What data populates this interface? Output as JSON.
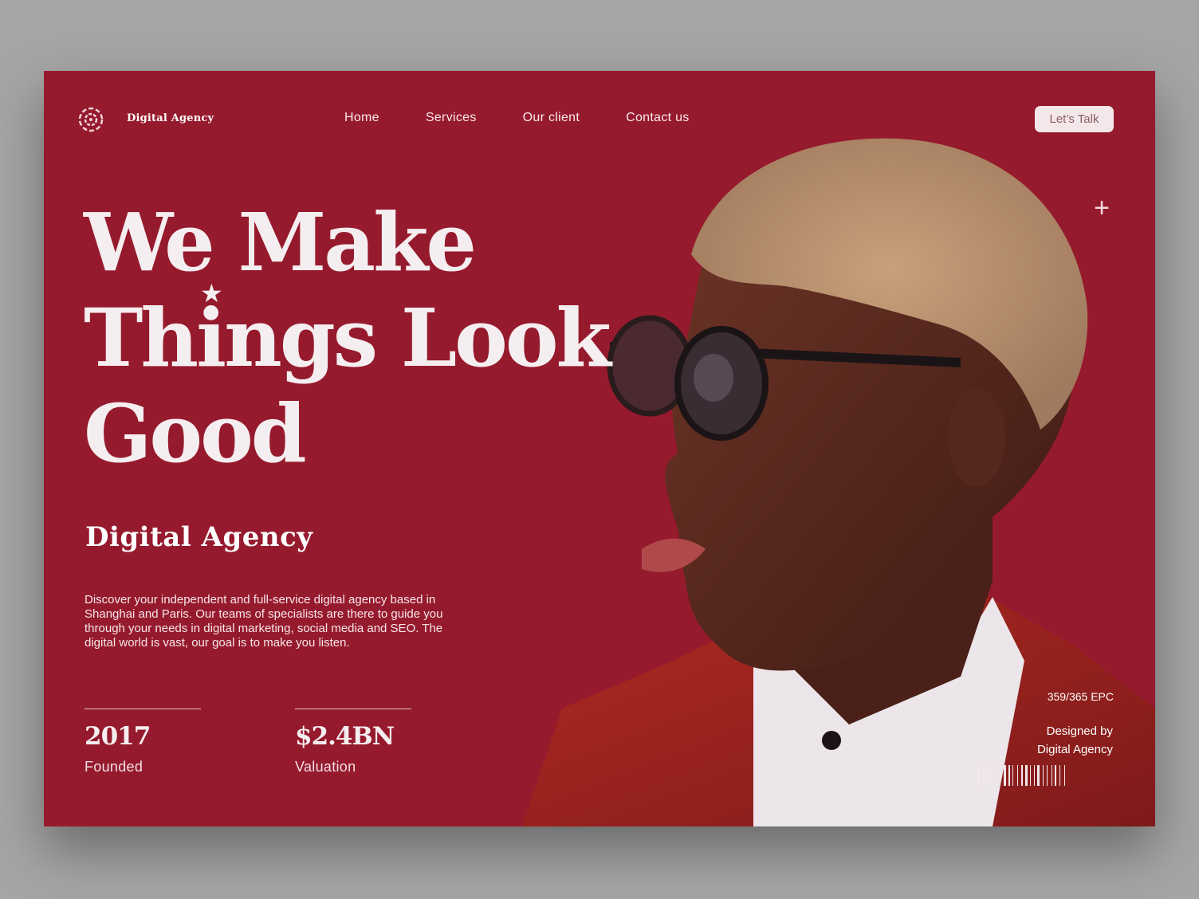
{
  "brand": {
    "name": "Digital Agency"
  },
  "nav": {
    "items": [
      "Home",
      "Services",
      "Our client",
      "Contact us"
    ],
    "cta_label": "Let’s Talk",
    "plus_symbol": "+"
  },
  "hero": {
    "headline": [
      "We Make",
      "Things Look",
      "Good"
    ],
    "subtitle": "Digital Agency",
    "description": "Discover your independent and full-service digital agency based in Shanghai and Paris. Our teams of specialists are there to guide you through your needs in digital marketing, social media and SEO. The digital world is vast, our goal is to make you listen."
  },
  "stats": [
    {
      "value": "2017",
      "label": "Founded"
    },
    {
      "value": "$2.4BN",
      "label": "Valuation"
    }
  ],
  "footer": {
    "epc": "359/365 EPC",
    "designed_by": [
      "Designed by",
      "Digital Agency"
    ]
  },
  "colors": {
    "background": "#961a2d",
    "page_gray": "#a5a5a5",
    "text_light": "#f5eef0",
    "cta_bg": "#f3e7ea"
  },
  "icons": [
    "logo-icon",
    "plus-icon",
    "star-icon",
    "barcode-icon"
  ]
}
